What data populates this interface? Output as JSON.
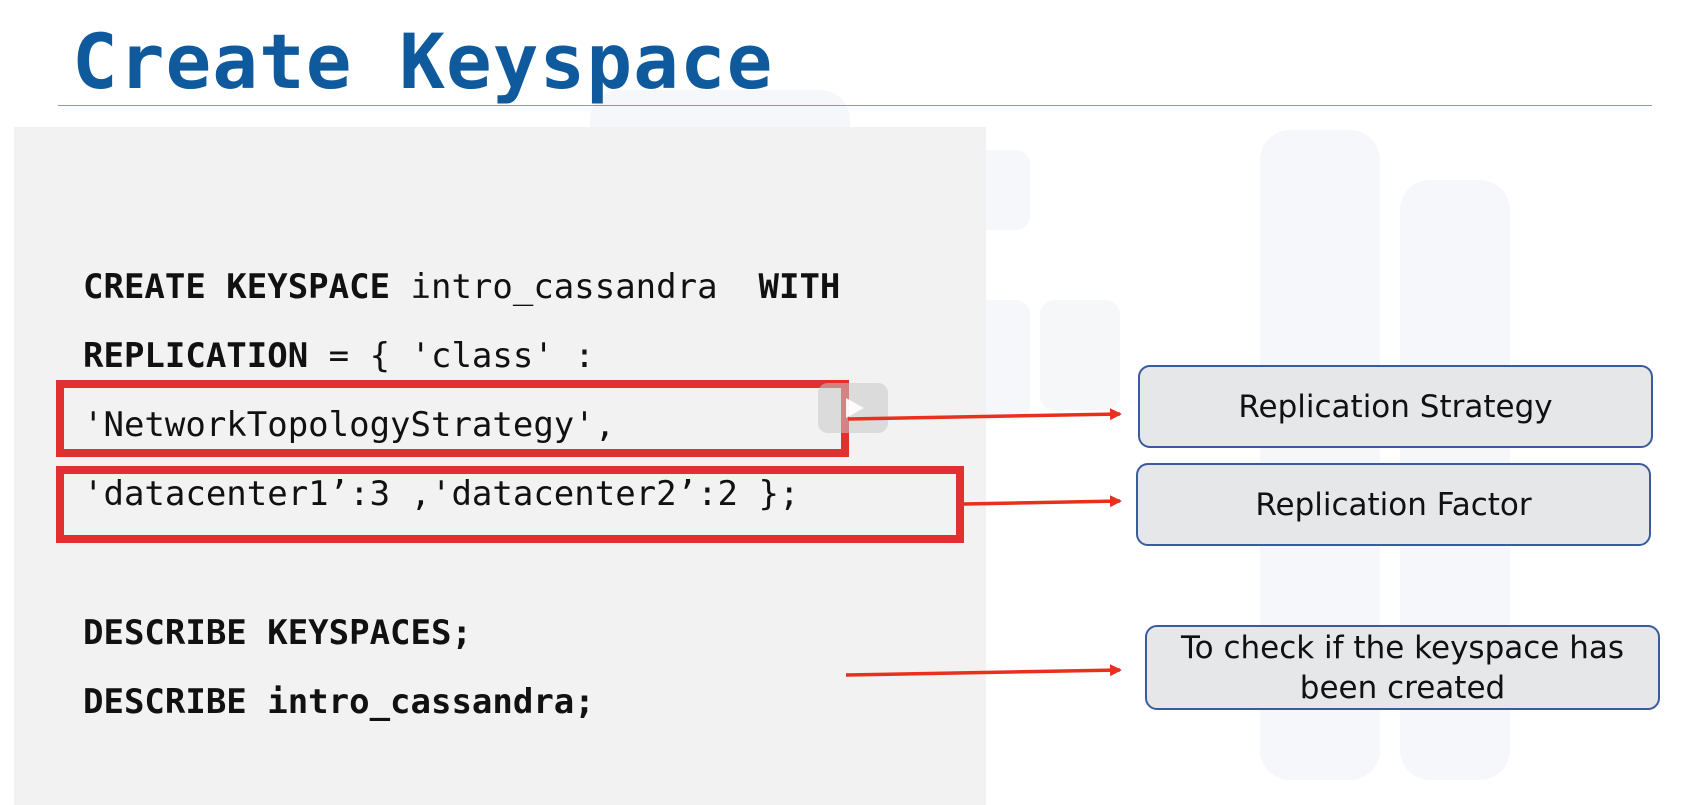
{
  "slide": {
    "title": "Create Keyspace"
  },
  "code": {
    "line1_kw1": "CREATE KEYSPACE",
    "line1_text": " intro_cassandra  ",
    "line1_kw2": "WITH",
    "line2_kw": "REPLICATION",
    "line2_text": " = { 'class' :",
    "line3_text": "'NetworkTopologyStrategy',",
    "line4_text": "'datacenter1’:3 ,'datacenter2’:2 };",
    "line5_text": "DESCRIBE KEYSPACES;",
    "line6_text": "DESCRIBE intro_cassandra;"
  },
  "callouts": {
    "strategy": "Replication Strategy",
    "factor": "Replication Factor",
    "check": "To check if the keyspace has been created"
  },
  "colors": {
    "title": "#0f5a9c",
    "highlight": "#e03030",
    "arrow": "#e8301c",
    "callout_border": "#3b5ba0",
    "callout_fill": "#e6e7e9",
    "panel": "#f2f2f2"
  }
}
